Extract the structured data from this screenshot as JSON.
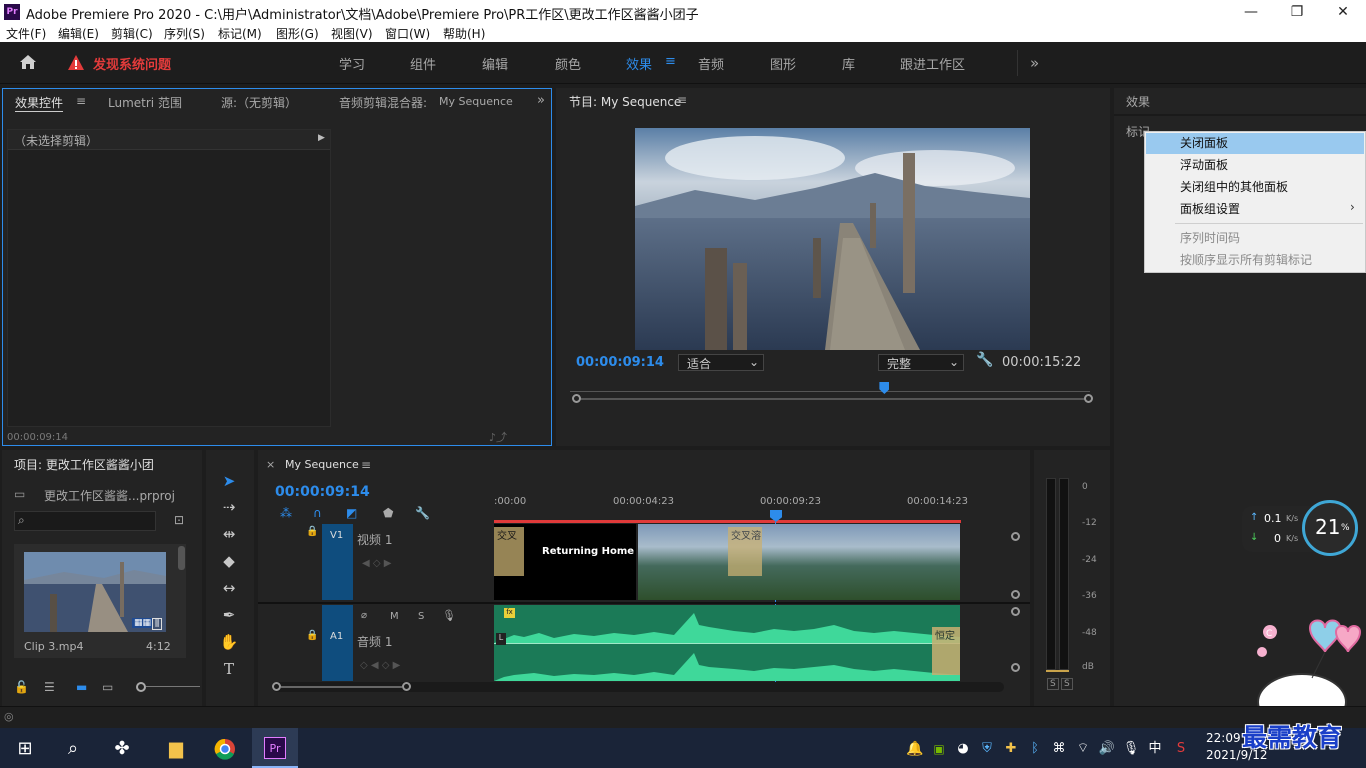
{
  "window": {
    "title": "Adobe Premiere Pro 2020 - C:\\用户\\Administrator\\文档\\Adobe\\Premiere Pro\\PR工作区\\更改工作区酱酱小团子",
    "app_icon": "Pr",
    "minimize": "—",
    "maximize": "❐",
    "close": "✕"
  },
  "menu": [
    "文件(F)",
    "编辑(E)",
    "剪辑(C)",
    "序列(S)",
    "标记(M)",
    "图形(G)",
    "视图(V)",
    "窗口(W)",
    "帮助(H)"
  ],
  "workspace": {
    "alert": "发现系统问题",
    "tabs": [
      "学习",
      "组件",
      "编辑",
      "颜色",
      "效果",
      "音频",
      "图形",
      "库",
      "跟进工作区"
    ],
    "active": "效果",
    "more": "»"
  },
  "effect_controls": {
    "tabs": [
      "效果控件",
      "Lumetri 范围",
      "源:（无剪辑）",
      "音频剪辑混合器:"
    ],
    "mixer_seq": "My Sequence",
    "no_clip": "（未选择剪辑）",
    "timecode": "00:00:09:14"
  },
  "program": {
    "title": "节目: My Sequence",
    "timecode": "00:00:09:14",
    "fit": "适合",
    "quality": "完整",
    "duration": "00:00:15:22",
    "playhead_fraction": 0.6
  },
  "right_panel": {
    "effects_title": "效果",
    "markers_title": "标记",
    "context_menu": [
      "关闭面板",
      "浮动面板",
      "关闭组中的其他面板",
      "面板组设置",
      "序列时间码",
      "按顺序显示所有剪辑标记"
    ]
  },
  "project": {
    "title": "项目: 更改工作区酱酱小团",
    "file": "更改工作区酱酱...prproj",
    "search_placeholder": "",
    "clip_name": "Clip 3.mp4",
    "clip_duration": "4:12"
  },
  "timeline": {
    "title": "My Sequence",
    "timecode": "00:00:09:14",
    "ruler": [
      ":00:00",
      "00:00:04:23",
      "00:00:09:23",
      "00:00:14:23"
    ],
    "v1": "V1",
    "video_label": "视频 1",
    "a1": "A1",
    "audio_label": "音频 1",
    "clip_title": "Returning Home",
    "transition1": "交叉",
    "transition2": "交叉溶",
    "audio_effect": "恒定",
    "fx": "fx",
    "m": "M",
    "s": "S"
  },
  "meter": {
    "scale": [
      "0",
      "-12",
      "-24",
      "-36",
      "-48",
      "dB"
    ],
    "solo": [
      "S",
      "S"
    ]
  },
  "net_widget": {
    "up": "0.1",
    "down": "0",
    "unit": "K/s",
    "percent": "21",
    "pct_sign": "%"
  },
  "taskbar": {
    "time": "22:09",
    "date": "2021/9/12",
    "ime": "中",
    "watermark": "最需教育"
  }
}
